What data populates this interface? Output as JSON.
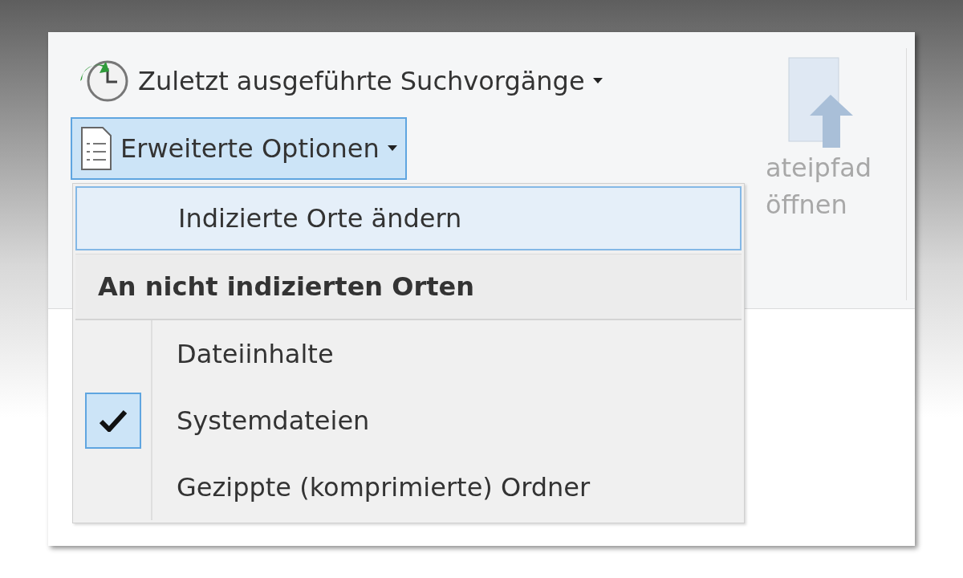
{
  "ribbon": {
    "recent_searches": {
      "label": "Zuletzt ausgeführte Suchvorgänge"
    },
    "advanced_options": {
      "label": "Erweiterte Optionen",
      "expanded": true
    },
    "open_file_path": {
      "lines": [
        "ateipfad",
        "öffnen"
      ],
      "disabled": true
    }
  },
  "menu": {
    "items": [
      {
        "kind": "command",
        "label": "Indizierte Orte ändern",
        "highlighted": true
      },
      {
        "kind": "header",
        "label": "An nicht indizierten Orten"
      },
      {
        "kind": "check",
        "label": "Dateiinhalte",
        "checked": false
      },
      {
        "kind": "check",
        "label": "Systemdateien",
        "checked": true
      },
      {
        "kind": "check",
        "label": "Gezippte (komprimierte) Ordner",
        "checked": false
      }
    ]
  }
}
